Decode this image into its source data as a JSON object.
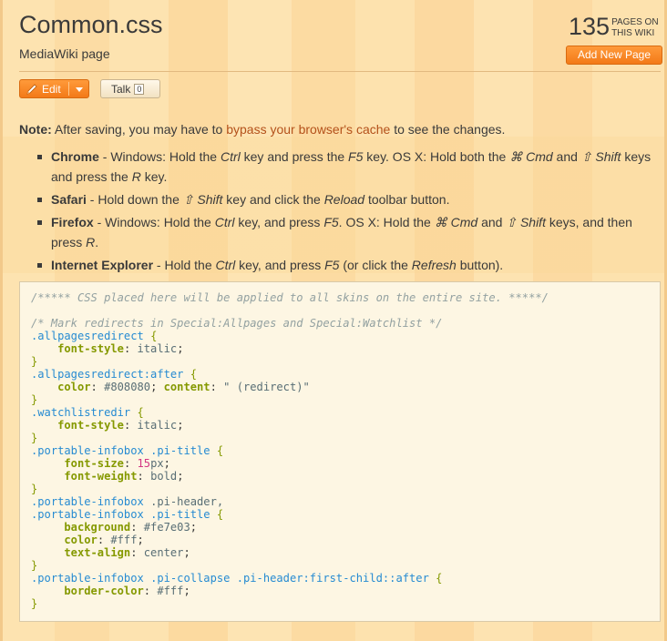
{
  "page": {
    "title": "Common.css",
    "subtitle": "MediaWiki page"
  },
  "counter": {
    "count": "135",
    "label_line1": "PAGES ON",
    "label_line2": "THIS WIKI"
  },
  "actions": {
    "add_new_page": "Add New Page",
    "edit_label": "Edit",
    "talk_label": "Talk",
    "talk_count": "0"
  },
  "note": {
    "lead": "Note:",
    "text_before": " After saving, you may have to ",
    "link": "bypass your browser's cache",
    "text_after": " to see the changes."
  },
  "browsers": [
    {
      "name": "Chrome",
      "t1": " - Windows: Hold the ",
      "k1": "Ctrl",
      "t2": " key and press the ",
      "k2": "F5",
      "t3": " key. OS X: Hold both the ",
      "k3": "⌘ Cmd",
      "t4": " and ",
      "k4": "⇧ Shift",
      "t5": " keys and press the ",
      "k5": "R",
      "t6": " key."
    },
    {
      "name": "Safari",
      "t1": " - Hold down the ",
      "k1": "⇧ Shift",
      "t2": " key and click the ",
      "k2": "Reload",
      "t3": " toolbar button."
    },
    {
      "name": "Firefox",
      "t1": " - Windows: Hold the ",
      "k1": "Ctrl",
      "t2": " key, and press ",
      "k2": "F5",
      "t3": ". OS X: Hold the ",
      "k3": "⌘ Cmd",
      "t4": " and ",
      "k4": "⇧ Shift",
      "t5": " keys, and then press ",
      "k5": "R",
      "t6": "."
    },
    {
      "name": "Internet Explorer",
      "t1": " - Hold the ",
      "k1": "Ctrl",
      "t2": " key, and press ",
      "k2": "F5",
      "t3": " (or click the ",
      "k3": "Refresh",
      "t4": " button)."
    }
  ],
  "code": {
    "comment1": "/***** CSS placed here will be applied to all skins on the entire site. *****/",
    "comment2": "/* Mark redirects in Special:Allpages and Special:Watchlist */",
    "sel1": ".allpagesredirect",
    "prop_fontstyle": "font-style",
    "val_italic": "italic",
    "sel2": ".allpagesredirect:after",
    "prop_color": "color",
    "val_808080": "#808080",
    "prop_content": "content",
    "val_redirect": "\" (redirect)\"",
    "sel3": ".watchlistredir",
    "sel4a": ".portable-infobox",
    "sel4b": ".pi-title",
    "prop_fontsize": "font-size",
    "num_15": "15",
    "unit_px": "px",
    "prop_fontweight": "font-weight",
    "val_bold": "bold",
    "sel5a": ".portable-infobox",
    "sel5b": ".pi-header,",
    "sel6a": ".portable-infobox",
    "sel6b": ".pi-title",
    "prop_background": "background",
    "val_fe7e03": "#fe7e03",
    "val_fff": "#fff",
    "prop_textalign": "text-align",
    "val_center": "center",
    "sel7a": ".portable-infobox",
    "sel7b": ".pi-collapse",
    "sel7c": ".pi-header:first-child::after",
    "prop_bordercolor": "border-color"
  },
  "colors": {
    "accent": "#f37a18",
    "link": "#b4511a"
  }
}
